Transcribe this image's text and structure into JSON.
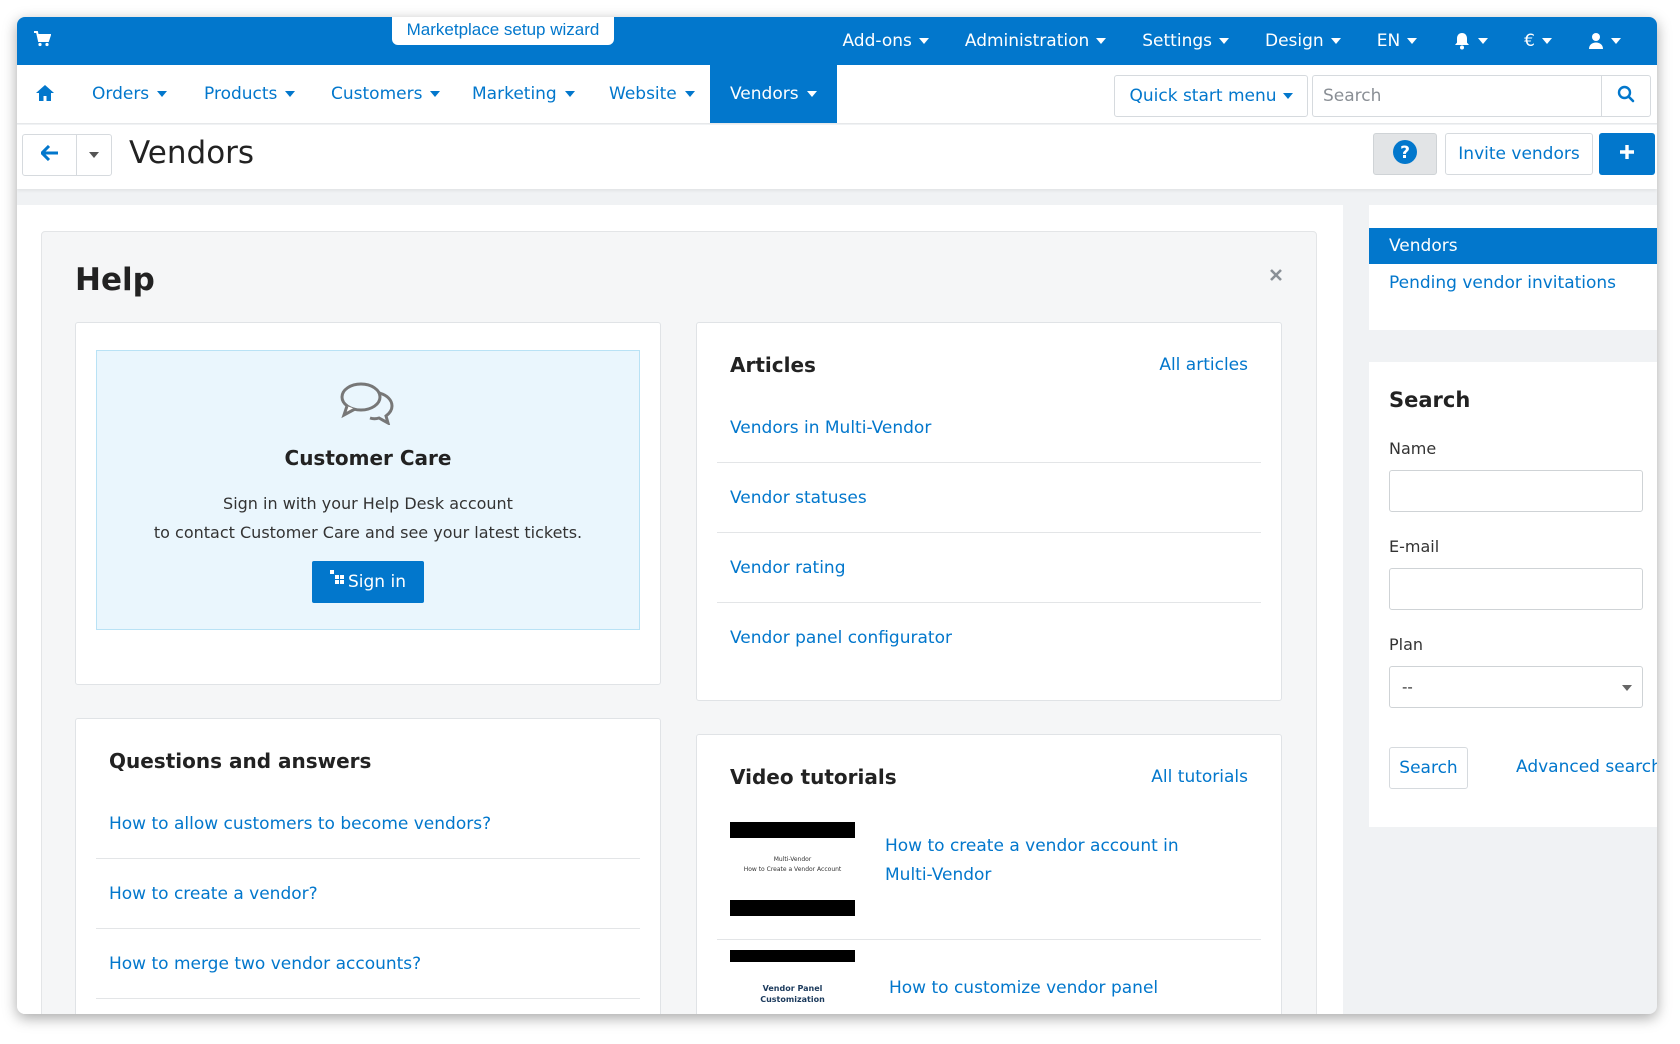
{
  "topbar": {
    "wizard_label": "Marketplace setup wizard",
    "menu": [
      {
        "label": "Add-ons"
      },
      {
        "label": "Administration"
      },
      {
        "label": "Settings"
      },
      {
        "label": "Design"
      },
      {
        "label": "EN"
      },
      {
        "label": "€"
      }
    ],
    "icons": [
      "cart-icon",
      "bell-icon",
      "user-icon"
    ]
  },
  "nav": {
    "items": [
      {
        "label": "Orders"
      },
      {
        "label": "Products"
      },
      {
        "label": "Customers"
      },
      {
        "label": "Marketing"
      },
      {
        "label": "Website"
      },
      {
        "label": "Vendors",
        "active": true
      }
    ],
    "quick_start": "Quick start menu",
    "search_placeholder": "Search"
  },
  "header": {
    "title": "Vendors",
    "invite_label": "Invite vendors"
  },
  "help": {
    "title": "Help",
    "customer_care": {
      "title": "Customer Care",
      "line1": "Sign in with your Help Desk account",
      "line2": "to contact Customer Care and see your latest tickets.",
      "button": "Sign in"
    },
    "articles": {
      "title": "Articles",
      "all_link": "All articles",
      "items": [
        "Vendors in Multi-Vendor",
        "Vendor statuses",
        "Vendor rating",
        "Vendor panel configurator"
      ]
    },
    "qa": {
      "title": "Questions and answers",
      "items": [
        "How to allow customers to become vendors?",
        "How to create a vendor?",
        "How to merge two vendor accounts?"
      ]
    },
    "videos": {
      "title": "Video tutorials",
      "all_link": "All tutorials",
      "items": [
        {
          "title": "How to create a vendor account in Multi-Vendor",
          "thumb_line1": "Multi-Vendor",
          "thumb_line2": "How to Create a Vendor Account"
        },
        {
          "title": "How to customize vendor panel",
          "thumb_line1": "Vendor Panel",
          "thumb_line2": "Customization"
        }
      ]
    }
  },
  "sidebar": {
    "nav": [
      "Vendors",
      "Pending vendor invitations"
    ],
    "search": {
      "title": "Search",
      "name_label": "Name",
      "email_label": "E-mail",
      "plan_label": "Plan",
      "plan_value": "--",
      "search_button": "Search",
      "advanced_link": "Advanced search"
    }
  },
  "colors": {
    "accent": "#0277cc",
    "topbar": "#0277cc"
  }
}
